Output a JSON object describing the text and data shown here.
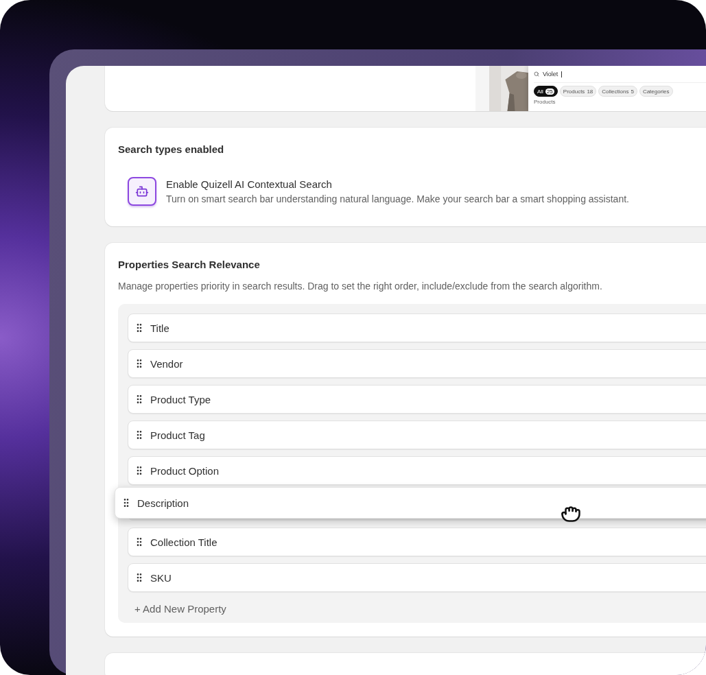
{
  "preview": {
    "search": {
      "value": "Violet"
    },
    "chips": [
      {
        "label": "All",
        "count": "25",
        "selected": true
      },
      {
        "label": "Products",
        "count": "18",
        "selected": false
      },
      {
        "label": "Collections",
        "count": "5",
        "selected": false
      },
      {
        "label": "Categories",
        "selected": false
      }
    ],
    "section_label": "Products"
  },
  "search_types": {
    "title": "Search types enabled",
    "items": [
      {
        "title": "Enable Quizell AI Contextual Search",
        "description": "Turn on smart search bar understanding natural language. Make your search bar a smart shopping assistant."
      }
    ]
  },
  "relevance": {
    "title": "Properties Search Relevance",
    "description": "Manage properties priority in search results. Drag to set the right order, include/exclude from the search algorithm.",
    "properties": [
      {
        "kind": "item",
        "label": "Title"
      },
      {
        "kind": "item",
        "label": "Vendor"
      },
      {
        "kind": "item",
        "label": "Product Type"
      },
      {
        "kind": "item",
        "label": "Product Tag"
      },
      {
        "kind": "item",
        "label": "Product Option"
      },
      {
        "kind": "placeholder"
      },
      {
        "kind": "item",
        "label": "Collection Title"
      },
      {
        "kind": "item",
        "label": "SKU"
      }
    ],
    "dragging": {
      "label": "Description"
    },
    "add_label": "+ Add New Property"
  }
}
